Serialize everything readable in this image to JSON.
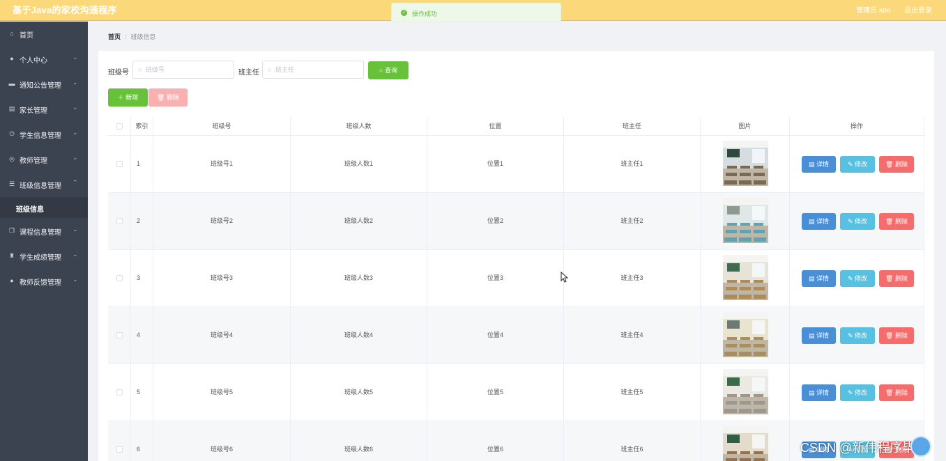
{
  "header": {
    "app_title": "基于Java的家校沟通程序",
    "user_label": "管理员 abo",
    "logout_label": "退出登录",
    "bg_color": "#fbd97a"
  },
  "toast": {
    "text": "操作成功"
  },
  "sidebar": {
    "items": [
      {
        "label": "首页",
        "icon": "home-icon"
      },
      {
        "label": "个人中心",
        "icon": "user-icon"
      },
      {
        "label": "通知公告管理",
        "icon": "briefcase-icon"
      },
      {
        "label": "家长管理",
        "icon": "document-icon"
      },
      {
        "label": "学生信息管理",
        "icon": "power-icon"
      },
      {
        "label": "教师管理",
        "icon": "compass-icon"
      },
      {
        "label": "班级信息管理",
        "icon": "list-icon"
      },
      {
        "label": "课程信息管理",
        "icon": "copy-icon"
      },
      {
        "label": "学生成绩管理",
        "icon": "trophy-icon"
      },
      {
        "label": "教师反馈管理",
        "icon": "user-icon"
      }
    ],
    "active_sub": "班级信息"
  },
  "breadcrumb": {
    "home": "首页",
    "current": "班级信息"
  },
  "search": {
    "class_label": "班级号",
    "class_placeholder": "班级号",
    "teacher_label": "班主任",
    "teacher_placeholder": "班主任",
    "query_label": "查询"
  },
  "toolbar": {
    "add_label": "新增",
    "delete_label": "删除"
  },
  "table": {
    "headers": [
      "索引",
      "班级号",
      "班级人数",
      "位置",
      "班主任",
      "图片",
      "操作"
    ],
    "action_labels": {
      "detail": "详情",
      "edit": "修改",
      "remove": "删除"
    },
    "rows": [
      {
        "index": "1",
        "class_no": "班级号1",
        "count": "班级人数1",
        "location": "位置1",
        "teacher": "班主任1"
      },
      {
        "index": "2",
        "class_no": "班级号2",
        "count": "班级人数2",
        "location": "位置2",
        "teacher": "班主任2"
      },
      {
        "index": "3",
        "class_no": "班级号3",
        "count": "班级人数3",
        "location": "位置3",
        "teacher": "班主任3"
      },
      {
        "index": "4",
        "class_no": "班级号4",
        "count": "班级人数4",
        "location": "位置4",
        "teacher": "班主任4"
      },
      {
        "index": "5",
        "class_no": "班级号5",
        "count": "班级人数5",
        "location": "位置5",
        "teacher": "班主任5"
      },
      {
        "index": "6",
        "class_no": "班级号6",
        "count": "班级人数6",
        "location": "位置6",
        "teacher": "班主任6"
      }
    ]
  },
  "watermark": "CSDN @新伟程序毕设"
}
